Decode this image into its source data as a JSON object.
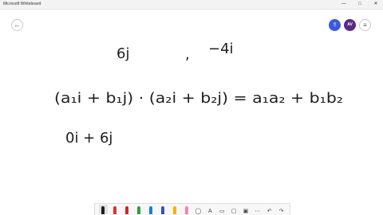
{
  "window": {
    "title": "Microsoft Whiteboard",
    "minimize": "—",
    "maximize": "□",
    "close": "✕"
  },
  "header": {
    "back_icon": "←",
    "share_icon": "⇪",
    "avatar_initials": "AV",
    "menu_icon": "≡"
  },
  "canvas": {
    "ink": {
      "row1_left": "6j",
      "row1_comma": ",",
      "row1_right": "−4i",
      "row2_left": "(a₁i + b₁j) · (a₂i + b₂j) = a₁a₂ + b₁b₂",
      "row3_left": "0i + 6j"
    }
  },
  "toolbar": {
    "tools": [
      {
        "name": "pen-black",
        "color": "#1e1e1e"
      },
      {
        "name": "pen-red",
        "color": "#e03131"
      },
      {
        "name": "pen-red-2",
        "color": "#c92a2a"
      },
      {
        "name": "pen-green",
        "color": "#2f9e44"
      },
      {
        "name": "pen-blue",
        "color": "#1c7ed6"
      },
      {
        "name": "pen-navy",
        "color": "#364fc7"
      },
      {
        "name": "highlighter",
        "color": "#fab005"
      },
      {
        "name": "eraser",
        "color": "#f783ac"
      }
    ],
    "lasso_icon": "◯",
    "text_icon": "A",
    "ruler_icon": "▭",
    "shapes_icon": "▢",
    "image_icon": "▣",
    "more_icon": "⋯",
    "undo_icon": "↶",
    "redo_icon": "↷"
  }
}
